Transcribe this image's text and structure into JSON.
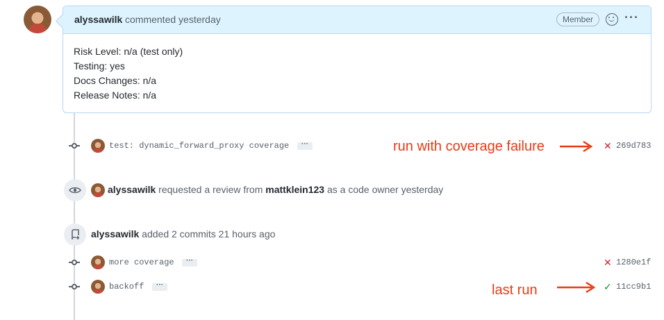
{
  "comment": {
    "author": "alyssawilk",
    "meta": "commented yesterday",
    "badge": "Member",
    "more_label": "···",
    "body": [
      "Risk Level: n/a (test only)",
      "Testing: yes",
      "Docs Changes: n/a",
      "Release Notes: n/a"
    ]
  },
  "commits_group_1": [
    {
      "message": "test: dynamic_forward_proxy coverage",
      "status": "failure",
      "status_glyph": "✕",
      "sha": "269d783",
      "ellipsis": "···"
    }
  ],
  "review_event": {
    "actor": "alyssawilk",
    "action": "requested a review from",
    "reviewer": "mattklein123",
    "suffix": "as a code owner yesterday"
  },
  "push_event": {
    "actor": "alyssawilk",
    "text": "added 2 commits 21 hours ago"
  },
  "commits_group_2": [
    {
      "message": "more coverage",
      "status": "failure",
      "status_glyph": "✕",
      "sha": "1280e1f",
      "ellipsis": "···"
    },
    {
      "message": "backoff",
      "status": "success",
      "status_glyph": "✓",
      "sha": "11cc9b1",
      "ellipsis": "···"
    }
  ],
  "annotations": {
    "coverage_failure": "run with coverage failure",
    "last_run": "last run"
  },
  "colors": {
    "annotation": "#ea3a14",
    "failure": "#cf222e",
    "success": "#1a7f37",
    "header_bg": "#ddf4ff"
  },
  "icons": [
    "eye-icon",
    "repo-push-icon",
    "commit-node-icon",
    "smiley-icon",
    "kebab-horizontal-icon"
  ]
}
